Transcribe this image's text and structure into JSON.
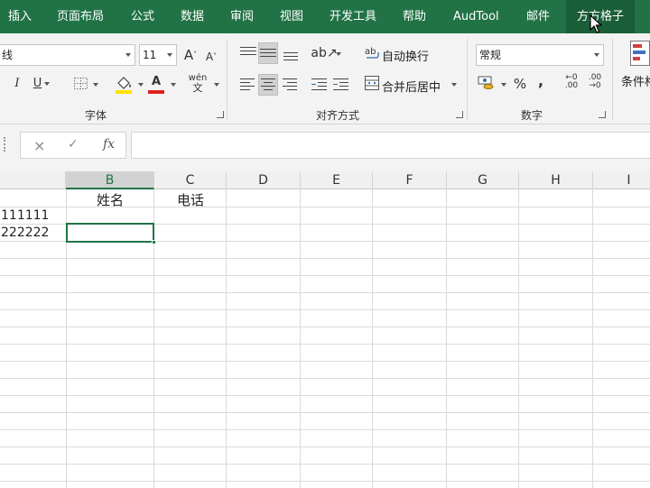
{
  "ribbon_tabs": [
    "插入",
    "页面布局",
    "公式",
    "数据",
    "审阅",
    "视图",
    "开发工具",
    "帮助",
    "AudTool",
    "邮件",
    "方方格子"
  ],
  "active_tab": "方方格子",
  "font": {
    "name_value": "线",
    "size_value": "11",
    "grow_label": "A",
    "shrink_label": "A",
    "italic_label": "I",
    "underline_label": "U",
    "font_color_label": "A",
    "phonetic_label": "wén",
    "group_label": "字体"
  },
  "alignment": {
    "wrap_text_label": "自动换行",
    "merge_center_label": "合并后居中",
    "group_label": "对齐方式"
  },
  "number": {
    "format_value": "常规",
    "percent_label": "%",
    "comma_label": ",",
    "group_label": "数字"
  },
  "styles": {
    "conditional_format_label": "条件格"
  },
  "formula_bar": {
    "cancel_icon": "×",
    "enter_icon": "✓",
    "function_label": "fx",
    "content": ""
  },
  "columns": [
    "B",
    "C",
    "D",
    "E",
    "F",
    "G",
    "H",
    "I"
  ],
  "active_column": "B",
  "cells": {
    "b1": "姓名",
    "c1": "电话",
    "a2": "111111",
    "a3": "222222"
  },
  "colors": {
    "accent": "#217346",
    "font_color_bar": "#e02020",
    "highlight_bar": "#ffe000"
  }
}
